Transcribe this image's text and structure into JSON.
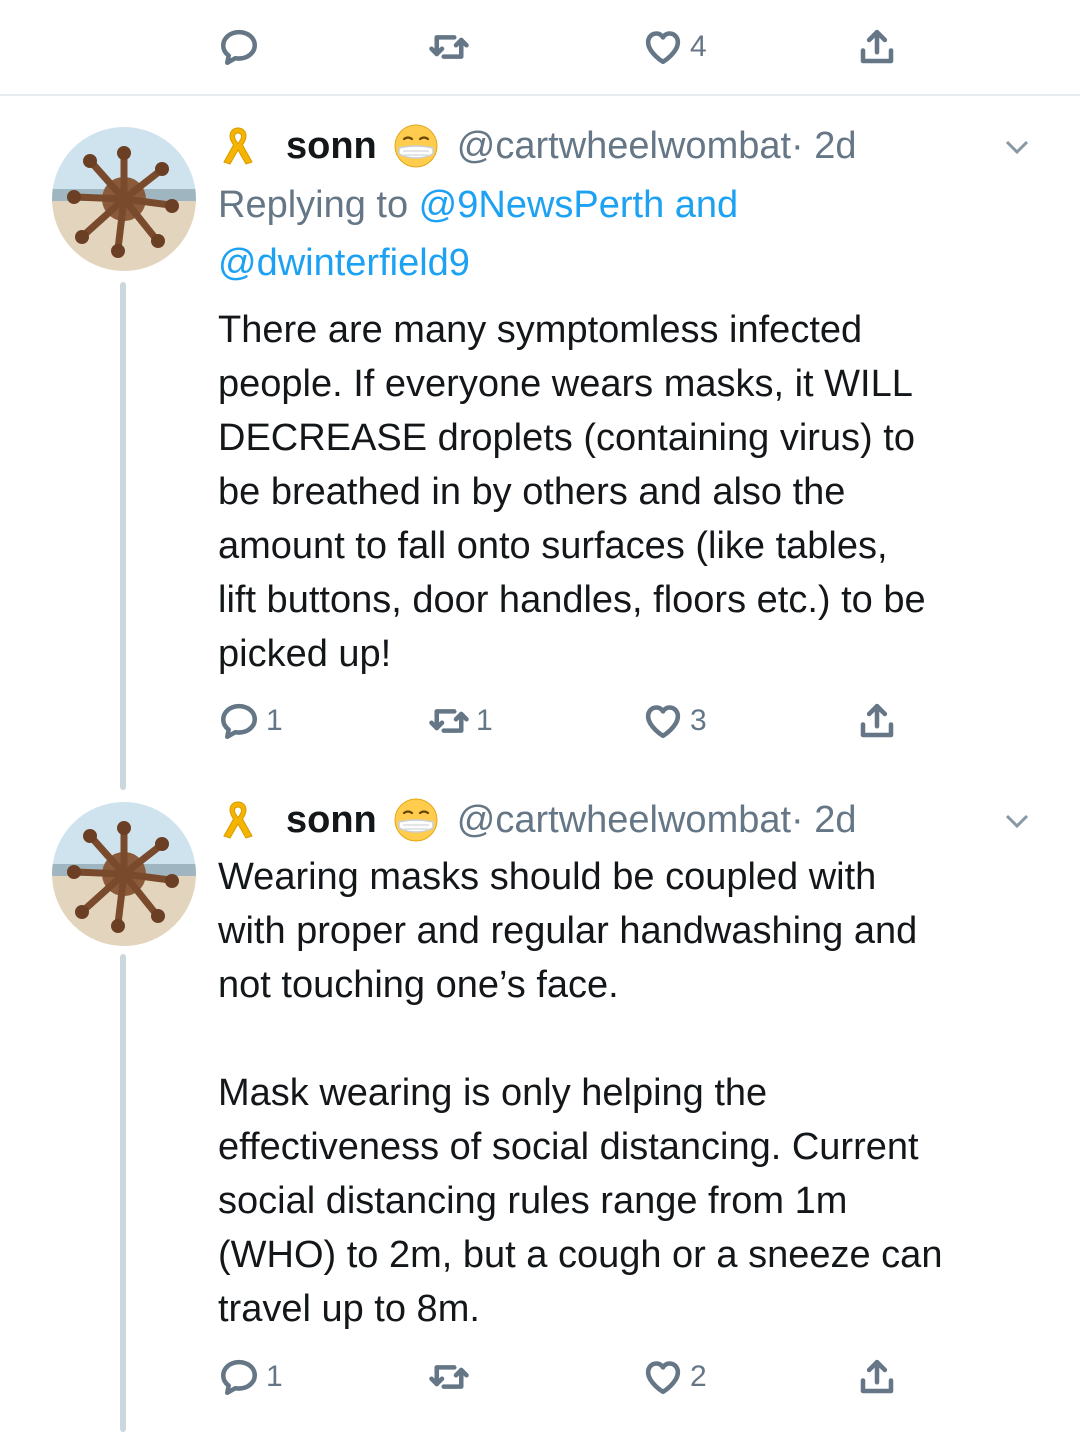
{
  "top_actions": {
    "reply_count": "",
    "retweet_count": "",
    "like_count": "4"
  },
  "tweets": [
    {
      "name": "sonn",
      "handle": "@cartwheelwombat",
      "time": "· 2d",
      "reply_prefix": "Replying to ",
      "reply_targets_line1": "@9NewsPerth and",
      "reply_targets_line2": "@dwinterfield9",
      "text": "There are many symptomless infected\npeople. If everyone wears masks, it WILL\nDECREASE droplets (containing virus) to\nbe breathed in by others and also the\namount to fall onto surfaces (like tables,\nlift buttons, door handles, floors etc.) to be\npicked up!",
      "reply_count": "1",
      "retweet_count": "1",
      "like_count": "3"
    },
    {
      "name": "sonn",
      "handle": "@cartwheelwombat",
      "time": "· 2d",
      "text": "Wearing masks should be coupled with\nwith proper and regular handwashing and\nnot touching one’s face.\n\nMask wearing is only helping the\neffectiveness of social distancing. Current\nsocial distancing rules range from 1m\n(WHO) to 2m, but a cough or a sneeze can\ntravel up to 8m.",
      "reply_count": "1",
      "retweet_count": "",
      "like_count": "2"
    }
  ],
  "icons": {
    "reply": "reply-icon",
    "retweet": "retweet-icon",
    "like": "heart-icon",
    "share": "share-icon",
    "more": "chevron-down-icon",
    "ribbon": "yellow-ribbon-icon",
    "mask": "medical-mask-emoji-icon"
  },
  "colors": {
    "link": "#1da1f2",
    "secondary": "#657786",
    "text": "#14171a",
    "divider": "#e6ecf0",
    "thread": "#ccd6dd"
  }
}
